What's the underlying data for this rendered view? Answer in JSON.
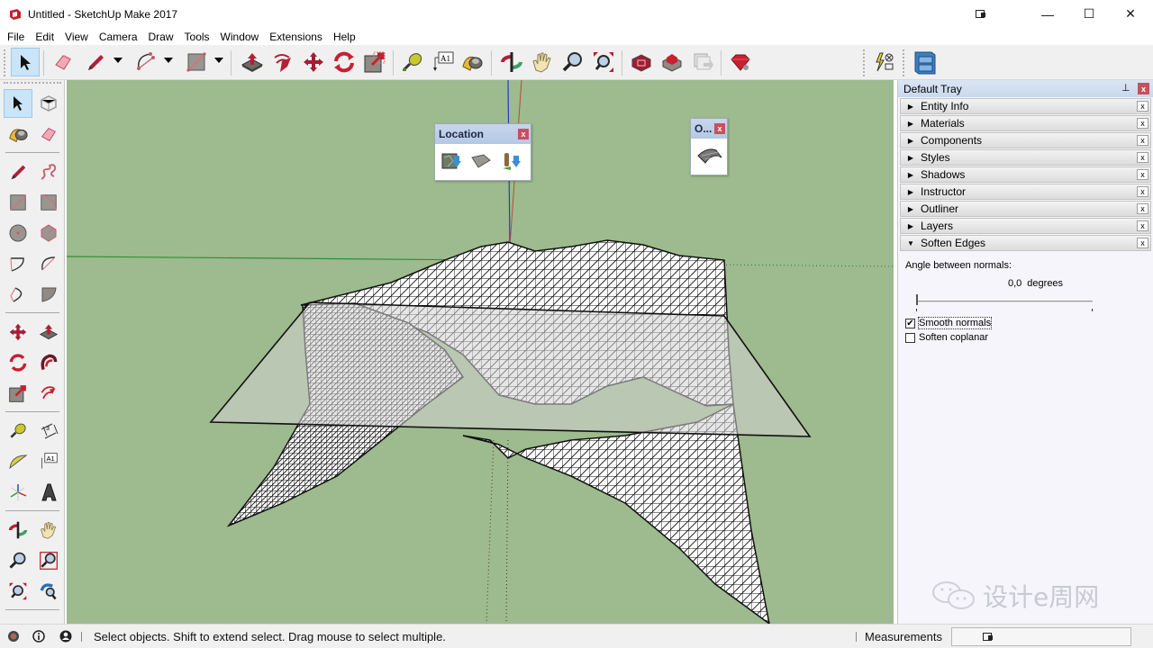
{
  "window": {
    "title": "Untitled - SketchUp Make 2017",
    "controls": {
      "restore_icon": "tablet-mode-icon",
      "minimize": "—",
      "maximize": "☐",
      "close": "✕"
    }
  },
  "menu": [
    "File",
    "Edit",
    "View",
    "Camera",
    "Draw",
    "Tools",
    "Window",
    "Extensions",
    "Help"
  ],
  "toolbar": {
    "tools": [
      {
        "name": "select-tool",
        "active": true
      },
      {
        "name": "eraser-tool"
      },
      {
        "name": "pencil-tool",
        "dropdown": true
      },
      {
        "name": "arc-tool",
        "dropdown": true
      },
      {
        "name": "rectangle-tool",
        "dropdown": true
      },
      {
        "name": "push-pull-tool"
      },
      {
        "name": "follow-me-tool"
      },
      {
        "name": "move-tool"
      },
      {
        "name": "rotate-tool"
      },
      {
        "name": "scale-tool"
      },
      {
        "name": "tape-measure-tool"
      },
      {
        "name": "text-tool",
        "glyph": "A1"
      },
      {
        "name": "paint-bucket-tool"
      },
      {
        "name": "orbit-tool"
      },
      {
        "name": "pan-tool"
      },
      {
        "name": "zoom-tool"
      },
      {
        "name": "zoom-extents-tool"
      },
      {
        "name": "warehouse-tool"
      },
      {
        "name": "extension-warehouse-tool"
      },
      {
        "name": "send-to-layout-tool"
      },
      {
        "name": "ruby-console-tool"
      },
      {
        "name": "sandbox-tool"
      },
      {
        "name": "components-tool"
      }
    ]
  },
  "location_panel": {
    "title": "Location",
    "close": "x",
    "buttons": [
      "add-location",
      "toggle-terrain",
      "photo-textures"
    ]
  },
  "o_panel": {
    "title": "O...",
    "close": "x",
    "buttons": [
      "smoove"
    ]
  },
  "tray": {
    "title": "Default Tray",
    "pin_icon": "pin-icon",
    "close": "x",
    "sections": [
      {
        "label": "Entity Info",
        "expanded": false
      },
      {
        "label": "Materials",
        "expanded": false
      },
      {
        "label": "Components",
        "expanded": false
      },
      {
        "label": "Styles",
        "expanded": false
      },
      {
        "label": "Shadows",
        "expanded": false
      },
      {
        "label": "Instructor",
        "expanded": false
      },
      {
        "label": "Outliner",
        "expanded": false
      },
      {
        "label": "Layers",
        "expanded": false
      },
      {
        "label": "Soften Edges",
        "expanded": true
      }
    ],
    "section_close": "x",
    "soften": {
      "angle_label": "Angle between normals:",
      "angle_value": "0,0",
      "angle_unit": "degrees",
      "slider_fraction": 0.0,
      "smooth_normals_label": "Smooth normals",
      "smooth_normals_checked": true,
      "soften_coplanar_label": "Soften coplanar",
      "soften_coplanar_checked": false
    }
  },
  "status": {
    "text": "Select objects. Shift to extend select. Drag mouse to select multiple.",
    "measurements_label": "Measurements",
    "measurements_value": ""
  },
  "watermark": {
    "text": "设计e周网"
  },
  "colors": {
    "viewport_bg": "#9dbb8e",
    "accent_red": "#b32035",
    "active_tool_bg": "#cce4f7"
  }
}
